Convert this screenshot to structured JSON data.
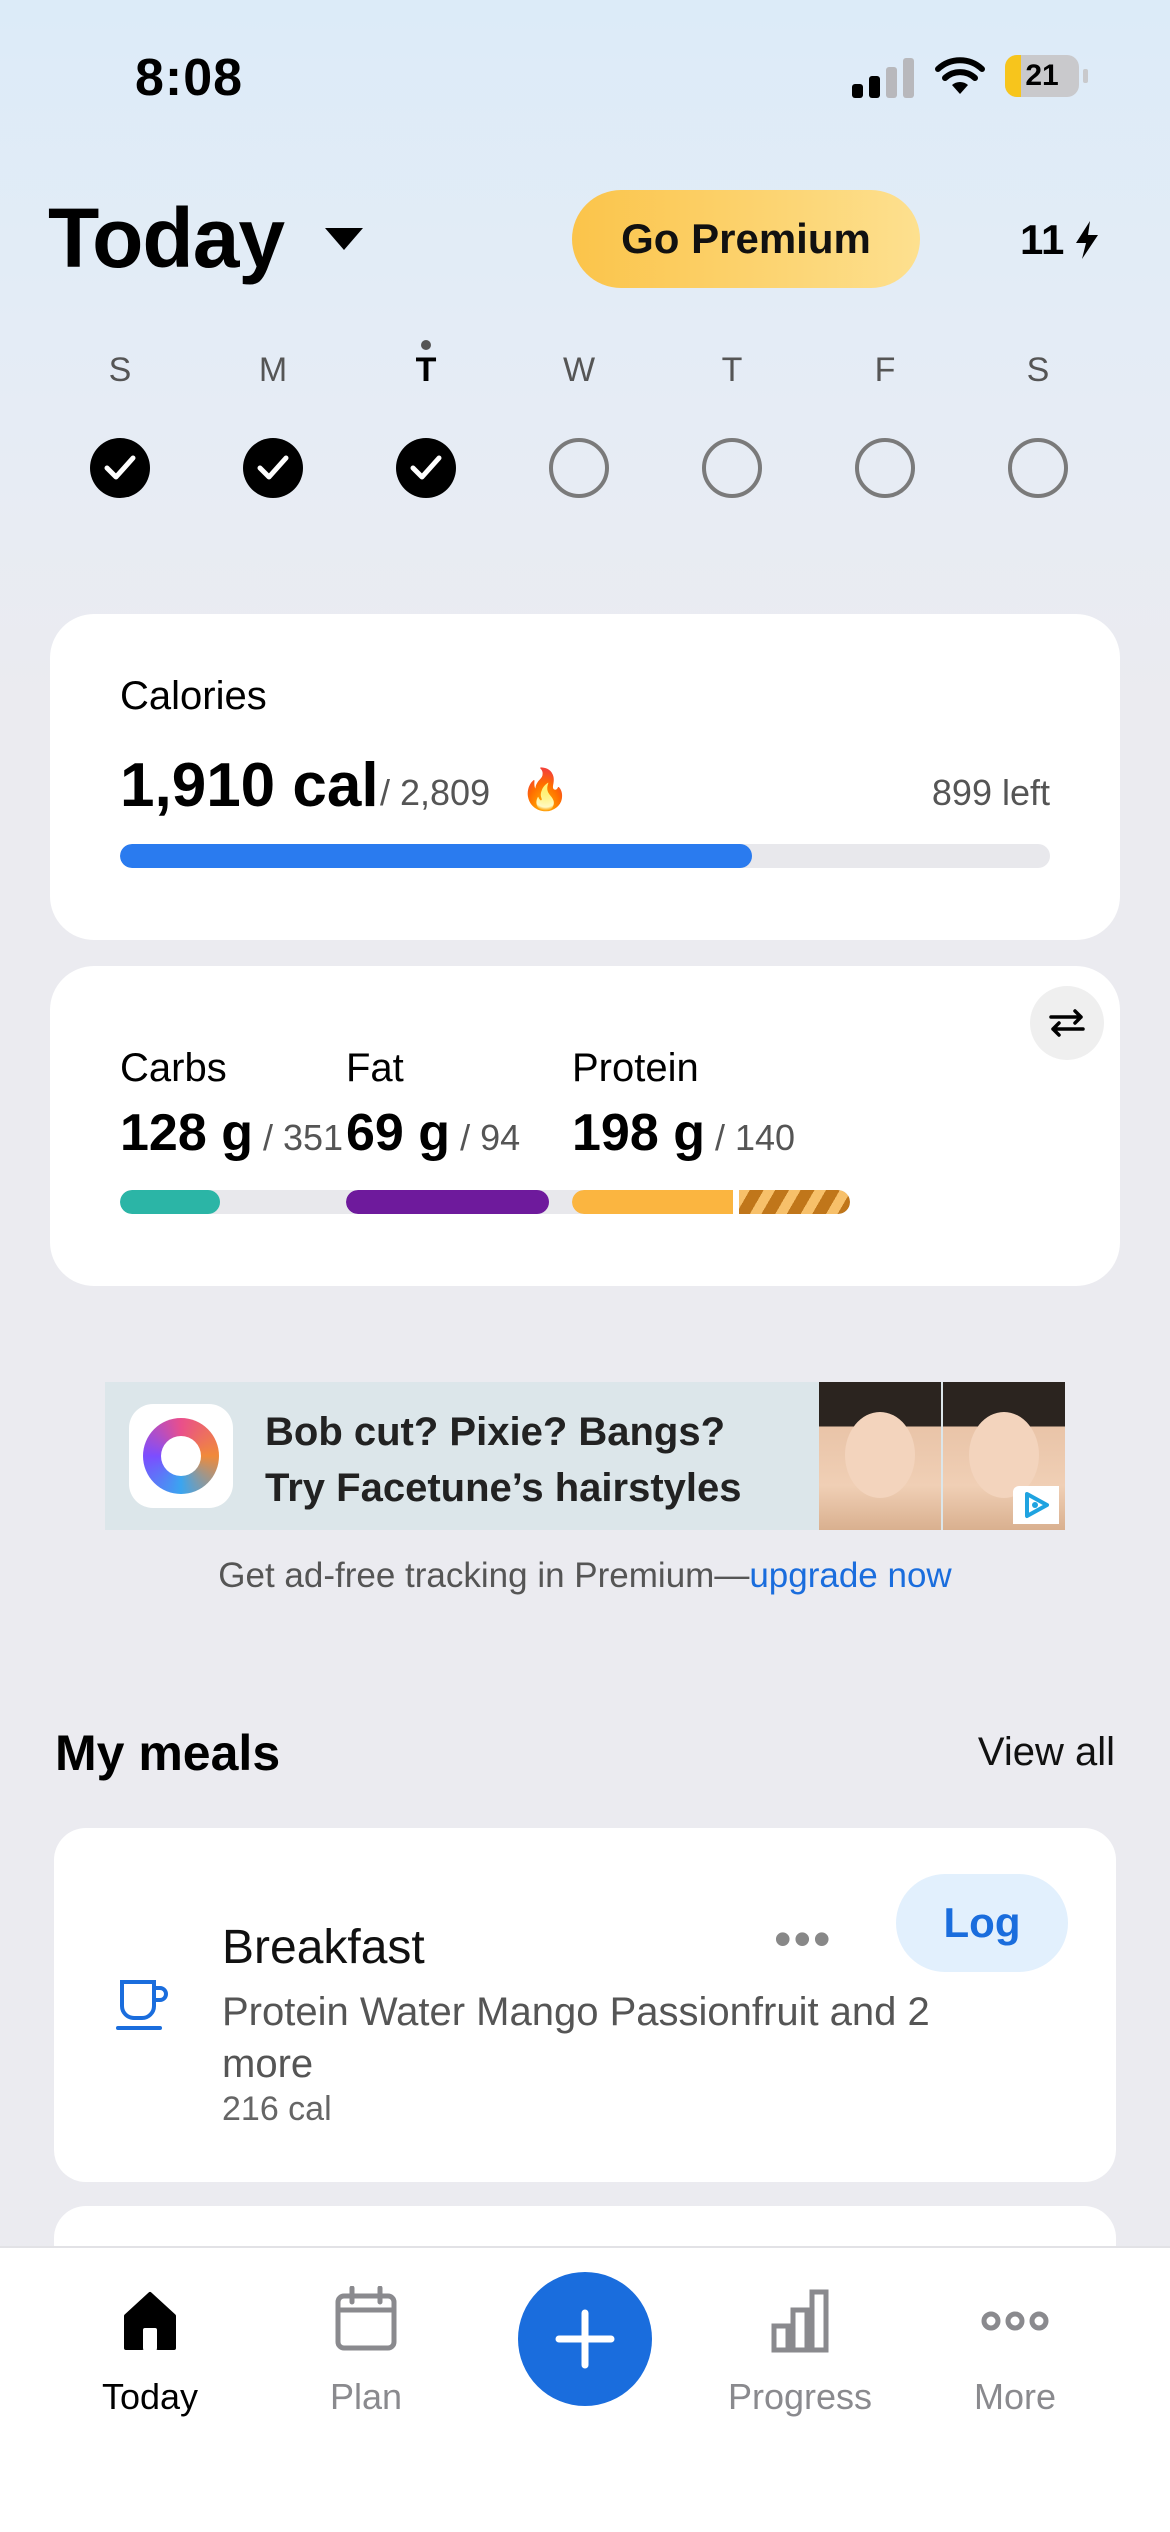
{
  "status_bar": {
    "time": "8:08",
    "battery": "21",
    "battery_level": 0.21
  },
  "header": {
    "title": "Today",
    "premium_label": "Go Premium",
    "streak_count": "11"
  },
  "week": {
    "days": [
      {
        "letter": "S",
        "done": true
      },
      {
        "letter": "M",
        "done": true
      },
      {
        "letter": "T",
        "done": true,
        "today": true
      },
      {
        "letter": "W",
        "done": false
      },
      {
        "letter": "T",
        "done": false
      },
      {
        "letter": "F",
        "done": false
      },
      {
        "letter": "S",
        "done": false
      }
    ]
  },
  "calories": {
    "label": "Calories",
    "value": "1,910 cal",
    "goal": "/ 2,809",
    "left": "899 left",
    "progress": 0.68,
    "color": "#2a7bef"
  },
  "macros": [
    {
      "name": "Carbs",
      "value": "128 g",
      "goal": "/ 351",
      "progress": 0.36,
      "color": "#2bb5a6"
    },
    {
      "name": "Fat",
      "value": "69 g",
      "goal": "/ 94",
      "progress": 0.73,
      "color": "#6e1a9c"
    },
    {
      "name": "Protein",
      "value": "198 g",
      "goal": "/ 140",
      "progress": 1.0,
      "over": true,
      "color": "#fbb540",
      "over_color": "#c0761a"
    }
  ],
  "ad": {
    "line1": "Bob cut? Pixie? Bangs?",
    "line2": "Try Facetune’s hairstyles",
    "upsell_text": "Get ad-free tracking in Premium—",
    "upsell_link": "upgrade now"
  },
  "meals": {
    "section_title": "My meals",
    "view_all": "View all",
    "items": [
      {
        "name": "Breakfast",
        "more": "•••",
        "log_label": "Log",
        "description": "Protein Water Mango Passionfruit and 2 more",
        "calories": "216 cal"
      }
    ]
  },
  "tab_bar": {
    "tabs": [
      {
        "label": "Today",
        "icon": "home-icon",
        "active": true
      },
      {
        "label": "Plan",
        "icon": "calendar-icon",
        "active": false
      },
      {
        "label": "Progress",
        "icon": "bar-chart-icon",
        "active": false
      },
      {
        "label": "More",
        "icon": "more-dots-icon",
        "active": false
      }
    ],
    "add_icon": "plus-icon"
  },
  "colors": {
    "accent": "#1a6ddd",
    "premium_start": "#fbc44a",
    "premium_end": "#fde08f"
  }
}
